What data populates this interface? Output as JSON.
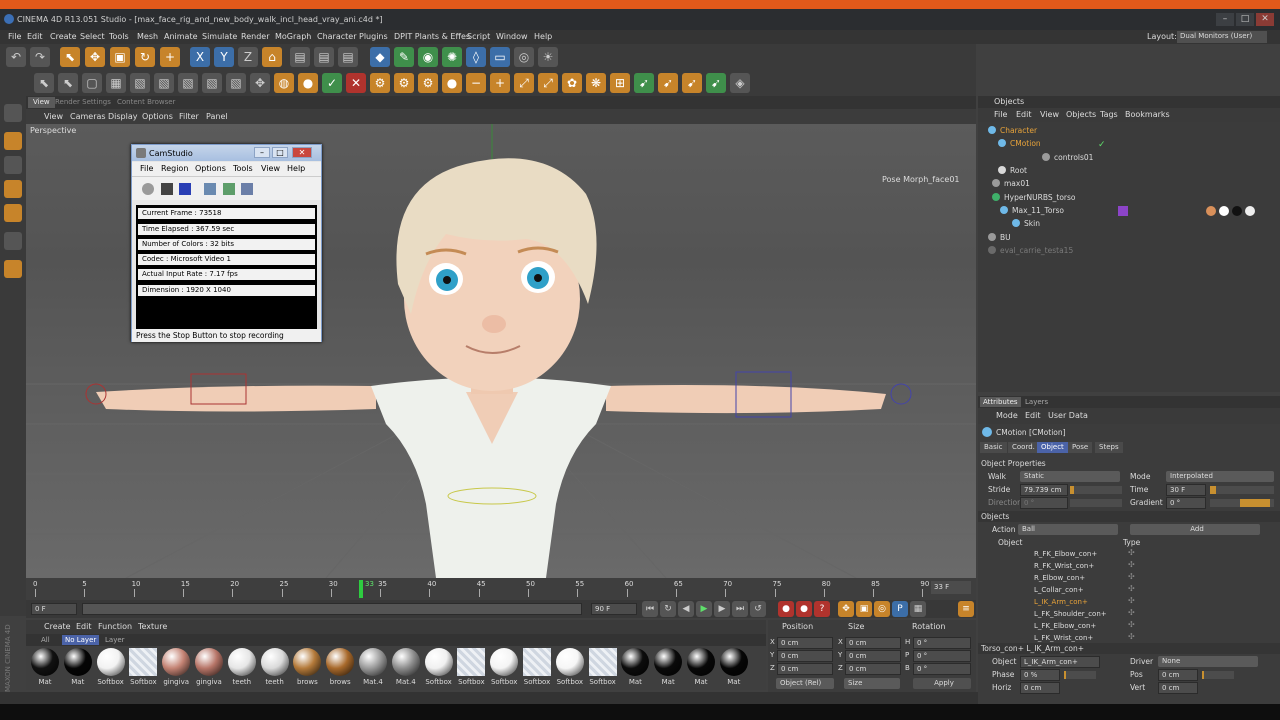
{
  "window": {
    "title": "CINEMA 4D R13.051 Studio - [max_face_rig_and_new_body_walk_incl_head_vray_ani.c4d *]",
    "minimize": "–",
    "maximize": "□",
    "close": "✕"
  },
  "menubar": {
    "items": [
      "File",
      "Edit",
      "Create",
      "Select",
      "Tools",
      "Mesh",
      "Animate",
      "Simulate",
      "Render",
      "MoGraph",
      "Character",
      "Plugins",
      "DPIT Plants & Effes",
      "Script",
      "Window",
      "Help"
    ],
    "layout_label": "Layout:",
    "layout_value": "Dual Monitors (User)"
  },
  "viewport": {
    "tabs": [
      "View",
      "Render Settings",
      "Content Browser"
    ],
    "menu": [
      "View",
      "Cameras",
      "Display",
      "Options",
      "Filter",
      "Panel"
    ],
    "label": "Perspective",
    "pose_label": "Pose Morph_face01"
  },
  "camstudio": {
    "title": "CamStudio",
    "menu": [
      "File",
      "Region",
      "Options",
      "Tools",
      "View",
      "Help"
    ],
    "rows": [
      "Current Frame : 73518",
      "Time Elapsed : 367.59 sec",
      "Number of Colors : 32 bits",
      "Codec : Microsoft Video 1",
      "Actual Input Rate : 7.17 fps",
      "Dimension : 1920 X 1040"
    ],
    "status": "Press the Stop Button to stop recording"
  },
  "timeline": {
    "ticks": [
      "0",
      "5",
      "10",
      "15",
      "20",
      "25",
      "30",
      "35",
      "40",
      "45",
      "50",
      "55",
      "60",
      "65",
      "70",
      "75",
      "80",
      "85",
      "90"
    ],
    "current": "33",
    "end_frame": "33 F",
    "start_field": "0 F",
    "end_field": "90 F"
  },
  "materials": {
    "menu": [
      "Create",
      "Edit",
      "Function",
      "Texture"
    ],
    "filters": [
      "All",
      "No Layer",
      "Layer"
    ],
    "items": [
      {
        "name": "Mat",
        "kind": "ball",
        "color": "#111111"
      },
      {
        "name": "Mat",
        "kind": "ball",
        "color": "#050505"
      },
      {
        "name": "Softbox",
        "kind": "ball",
        "color": "#f2f2f2"
      },
      {
        "name": "Softbox",
        "kind": "sq",
        "color": "#dde3ea"
      },
      {
        "name": "gingiva",
        "kind": "ball",
        "color": "#c48374"
      },
      {
        "name": "gingiva",
        "kind": "ball",
        "color": "#b77568"
      },
      {
        "name": "teeth",
        "kind": "ball",
        "color": "#e6e6e6"
      },
      {
        "name": "teeth",
        "kind": "ball",
        "color": "#dadada"
      },
      {
        "name": "brows",
        "kind": "ball",
        "color": "#b47a3a"
      },
      {
        "name": "brows",
        "kind": "ball",
        "color": "#a8692b"
      },
      {
        "name": "Mat.4",
        "kind": "ball",
        "color": "#9a9a9a"
      },
      {
        "name": "Mat.4",
        "kind": "ball",
        "color": "#8d8d8d"
      },
      {
        "name": "Softbox",
        "kind": "ball",
        "color": "#f0f0f0"
      },
      {
        "name": "Softbox",
        "kind": "sq",
        "color": "#dde3ea"
      },
      {
        "name": "Softbox",
        "kind": "ball",
        "color": "#f4f4f4"
      },
      {
        "name": "Softbox",
        "kind": "sq",
        "color": "#dde3ea"
      },
      {
        "name": "Softbox",
        "kind": "ball",
        "color": "#f6f6f6"
      },
      {
        "name": "Softbox",
        "kind": "sq",
        "color": "#dde3ea"
      },
      {
        "name": "Mat",
        "kind": "ball",
        "color": "#0c0c0c"
      },
      {
        "name": "Mat",
        "kind": "ball",
        "color": "#0a0a0a"
      },
      {
        "name": "Mat",
        "kind": "ball",
        "color": "#080808"
      },
      {
        "name": "Mat",
        "kind": "ball",
        "color": "#060606"
      }
    ]
  },
  "coords": {
    "headers": [
      "Position",
      "Size",
      "Rotation"
    ],
    "rows": [
      {
        "axis": "X",
        "pos": "0 cm",
        "size_axis": "X",
        "size": "0 cm",
        "rot_axis": "H",
        "rot": "0 °"
      },
      {
        "axis": "Y",
        "pos": "0 cm",
        "size_axis": "Y",
        "size": "0 cm",
        "rot_axis": "P",
        "rot": "0 °"
      },
      {
        "axis": "Z",
        "pos": "0 cm",
        "size_axis": "Z",
        "size": "0 cm",
        "rot_axis": "B",
        "rot": "0 °"
      }
    ],
    "mode1": "Object (Rel)",
    "mode2": "Size",
    "apply": "Apply"
  },
  "objects": {
    "title": "Objects",
    "menu": [
      "File",
      "Edit",
      "View",
      "Objects",
      "Tags",
      "Bookmarks"
    ],
    "items": [
      {
        "name": "Character",
        "style": "orange",
        "icon": "#6fb9e8"
      },
      {
        "name": "CMotion",
        "style": "orange",
        "icon": "#6fb9e8"
      },
      {
        "name": "controls01",
        "style": "",
        "icon": "#9a9a9a"
      },
      {
        "name": "Root",
        "style": "",
        "icon": "#d8d8d8"
      },
      {
        "name": "max01",
        "style": "",
        "icon": "#9a9a9a"
      },
      {
        "name": "HyperNURBS_torso",
        "style": "",
        "icon": "#3fb06a"
      },
      {
        "name": "Max_11_Torso",
        "style": "",
        "icon": "#6fb9e8"
      },
      {
        "name": "Skin",
        "style": "",
        "icon": "#6fb9e8"
      },
      {
        "name": "BU",
        "style": "",
        "icon": "#9a9a9a"
      },
      {
        "name": "eval_carrie_testa15",
        "style": "dim",
        "icon": "#6a6a6a"
      }
    ]
  },
  "attributes": {
    "tabs": [
      "Attributes",
      "Layers"
    ],
    "menu": [
      "Mode",
      "Edit",
      "User Data"
    ],
    "object_name": "CMotion [CMotion]",
    "subtabs": [
      "Basic",
      "Coord.",
      "Object",
      "Pose",
      "Steps"
    ],
    "section_props": "Object Properties",
    "walk_label": "Walk",
    "walk_value": "Static",
    "mode_label": "Mode",
    "mode_value": "Interpolated",
    "stride_label": "Stride",
    "stride_value": "79.739 cm",
    "time_label": "Time",
    "time_value": "30 F",
    "direction_label": "Direction",
    "direction_value": "0 °",
    "gradient_label": "Gradient",
    "gradient_value": "0 °",
    "section_objects": "Objects",
    "action_label": "Action",
    "action_value": "Ball",
    "add": "Add",
    "col_object": "Object",
    "col_type": "Type",
    "list": [
      "R_FK_Elbow_con+",
      "R_FK_Wrist_con+",
      "R_Elbow_con+",
      "L_Collar_con+",
      "L_IK_Arm_con+",
      "L_FK_Shoulder_con+",
      "L_FK_Elbow_con+",
      "L_FK_Wrist_con+"
    ],
    "list_highlight": 4,
    "section_torso": "Torso_con+ L_IK_Arm_con+",
    "obj_label": "Object",
    "obj_value": "L_IK_Arm_con+",
    "driver_label": "Driver",
    "driver_value": "None",
    "phase_label": "Phase",
    "phase_value": "0 %",
    "pos_label": "Pos",
    "pos_value": "0 cm",
    "horiz_label": "Horiz",
    "horiz_value": "0 cm",
    "vert_label": "Vert",
    "vert_value": "0 cm"
  },
  "colors": {
    "accent_orange": "#e2591a",
    "panel": "#3c3c3c",
    "selection_blue": "#4b63a8"
  }
}
